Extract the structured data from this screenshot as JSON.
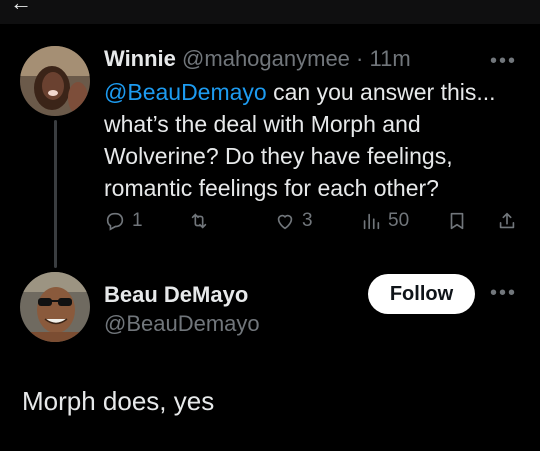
{
  "reply": {
    "author_name": "Winnie",
    "author_handle": "@mahoganymee",
    "separator": "·",
    "time": "11m",
    "mention": "@BeauDemayo",
    "text": " can you answer this... what’s the deal with Morph and Wolverine? Do they have feelings, romantic feelings for each other?",
    "more": "•••",
    "replies": "1",
    "reposts": "",
    "likes": "3",
    "views": "50"
  },
  "main_tweet": {
    "author_name": "Beau DeMayo",
    "author_handle": "@BeauDemayo",
    "follow_label": "Follow",
    "more": "•••",
    "text": "Morph does, yes"
  },
  "icons": {
    "reply": "reply-icon",
    "repost": "repost-icon",
    "like": "like-icon",
    "views": "views-icon",
    "bookmark": "bookmark-icon",
    "share": "share-icon"
  },
  "colors": {
    "background": "#000000",
    "text": "#e7e9ea",
    "muted": "#71767b",
    "link": "#1d9bf0",
    "follow_bg": "#ffffff"
  }
}
